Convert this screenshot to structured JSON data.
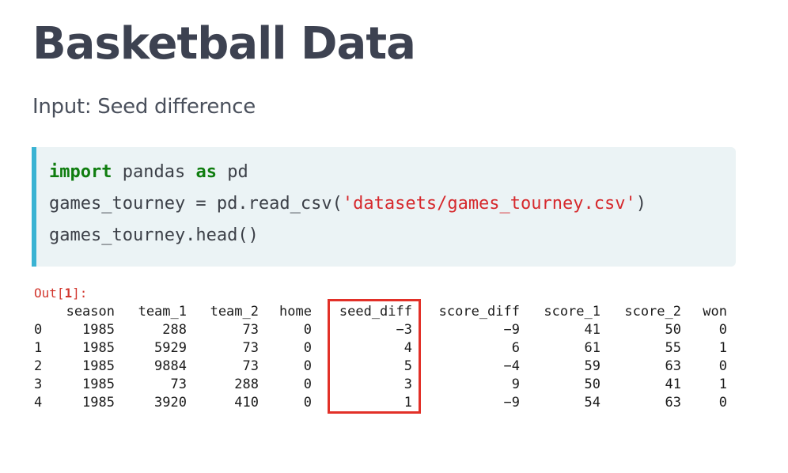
{
  "title": "Basketball Data",
  "subtitle": "Input: Seed difference",
  "code": {
    "line1": {
      "kw1": "import",
      "mid1": " pandas ",
      "kw2": "as",
      "end": " pd"
    },
    "line2": {
      "prefix": "games_tourney = pd.read_csv(",
      "string": "'datasets/games_tourney.csv'",
      "suffix": ")"
    },
    "line3": "games_tourney.head()"
  },
  "output": {
    "prompt_prefix": "Out[",
    "prompt_number": "1",
    "prompt_suffix": "]:"
  },
  "table": {
    "columns": [
      "season",
      "team_1",
      "team_2",
      "home",
      "seed_diff",
      "score_diff",
      "score_1",
      "score_2",
      "won"
    ],
    "highlighted_column": "seed_diff",
    "highlight_color": "#e23028",
    "rows": [
      [
        "0",
        "1985",
        "288",
        "73",
        "0",
        "-3",
        "-9",
        "41",
        "50",
        "0"
      ],
      [
        "1",
        "1985",
        "5929",
        "73",
        "0",
        "4",
        "6",
        "61",
        "55",
        "1"
      ],
      [
        "2",
        "1985",
        "9884",
        "73",
        "0",
        "5",
        "-4",
        "59",
        "63",
        "0"
      ],
      [
        "3",
        "1985",
        "73",
        "288",
        "0",
        "3",
        "9",
        "50",
        "41",
        "1"
      ],
      [
        "4",
        "1985",
        "3920",
        "410",
        "0",
        "1",
        "-9",
        "54",
        "63",
        "0"
      ]
    ]
  }
}
